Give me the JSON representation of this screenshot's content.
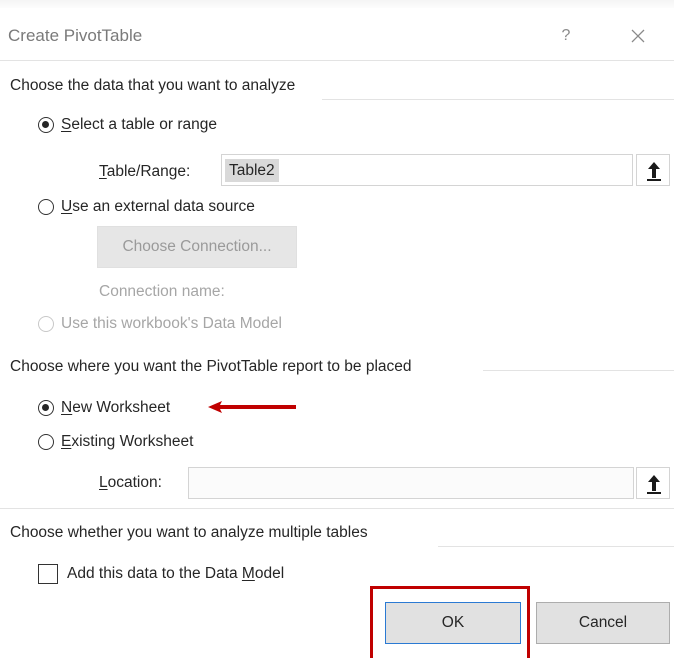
{
  "dialog": {
    "title": "Create PivotTable",
    "help_symbol": "?"
  },
  "data_source": {
    "heading": "Choose the data that you want to analyze",
    "select_table": {
      "accel": "S",
      "rest": "elect a table or range",
      "checked": true
    },
    "table_range": {
      "accel": "T",
      "rest": "able/Range:",
      "value": "Table2"
    },
    "external": {
      "accel": "U",
      "rest": "se an external data source",
      "checked": false
    },
    "choose_connection_label": "Choose Connection...",
    "connection_name_label": "Connection name:",
    "data_model_option": {
      "label": "Use this workbook's Data Model",
      "disabled": true
    }
  },
  "placement": {
    "heading": "Choose where you want the PivotTable report to be placed",
    "new_worksheet": {
      "accel": "N",
      "rest": "ew Worksheet",
      "checked": true
    },
    "existing_worksheet": {
      "accel": "E",
      "rest": "xisting Worksheet",
      "checked": false
    },
    "location": {
      "accel": "L",
      "rest": "ocation:",
      "value": ""
    }
  },
  "multiple_tables": {
    "heading": "Choose whether you want to analyze multiple tables",
    "add_to_model": {
      "prefix": "Add this data to the Data ",
      "accel": "M",
      "rest": "odel",
      "checked": false
    }
  },
  "buttons": {
    "ok_label": "OK",
    "cancel_label": "Cancel"
  },
  "annotation_color": "#c00000",
  "accent_color": "#2b7ad3"
}
